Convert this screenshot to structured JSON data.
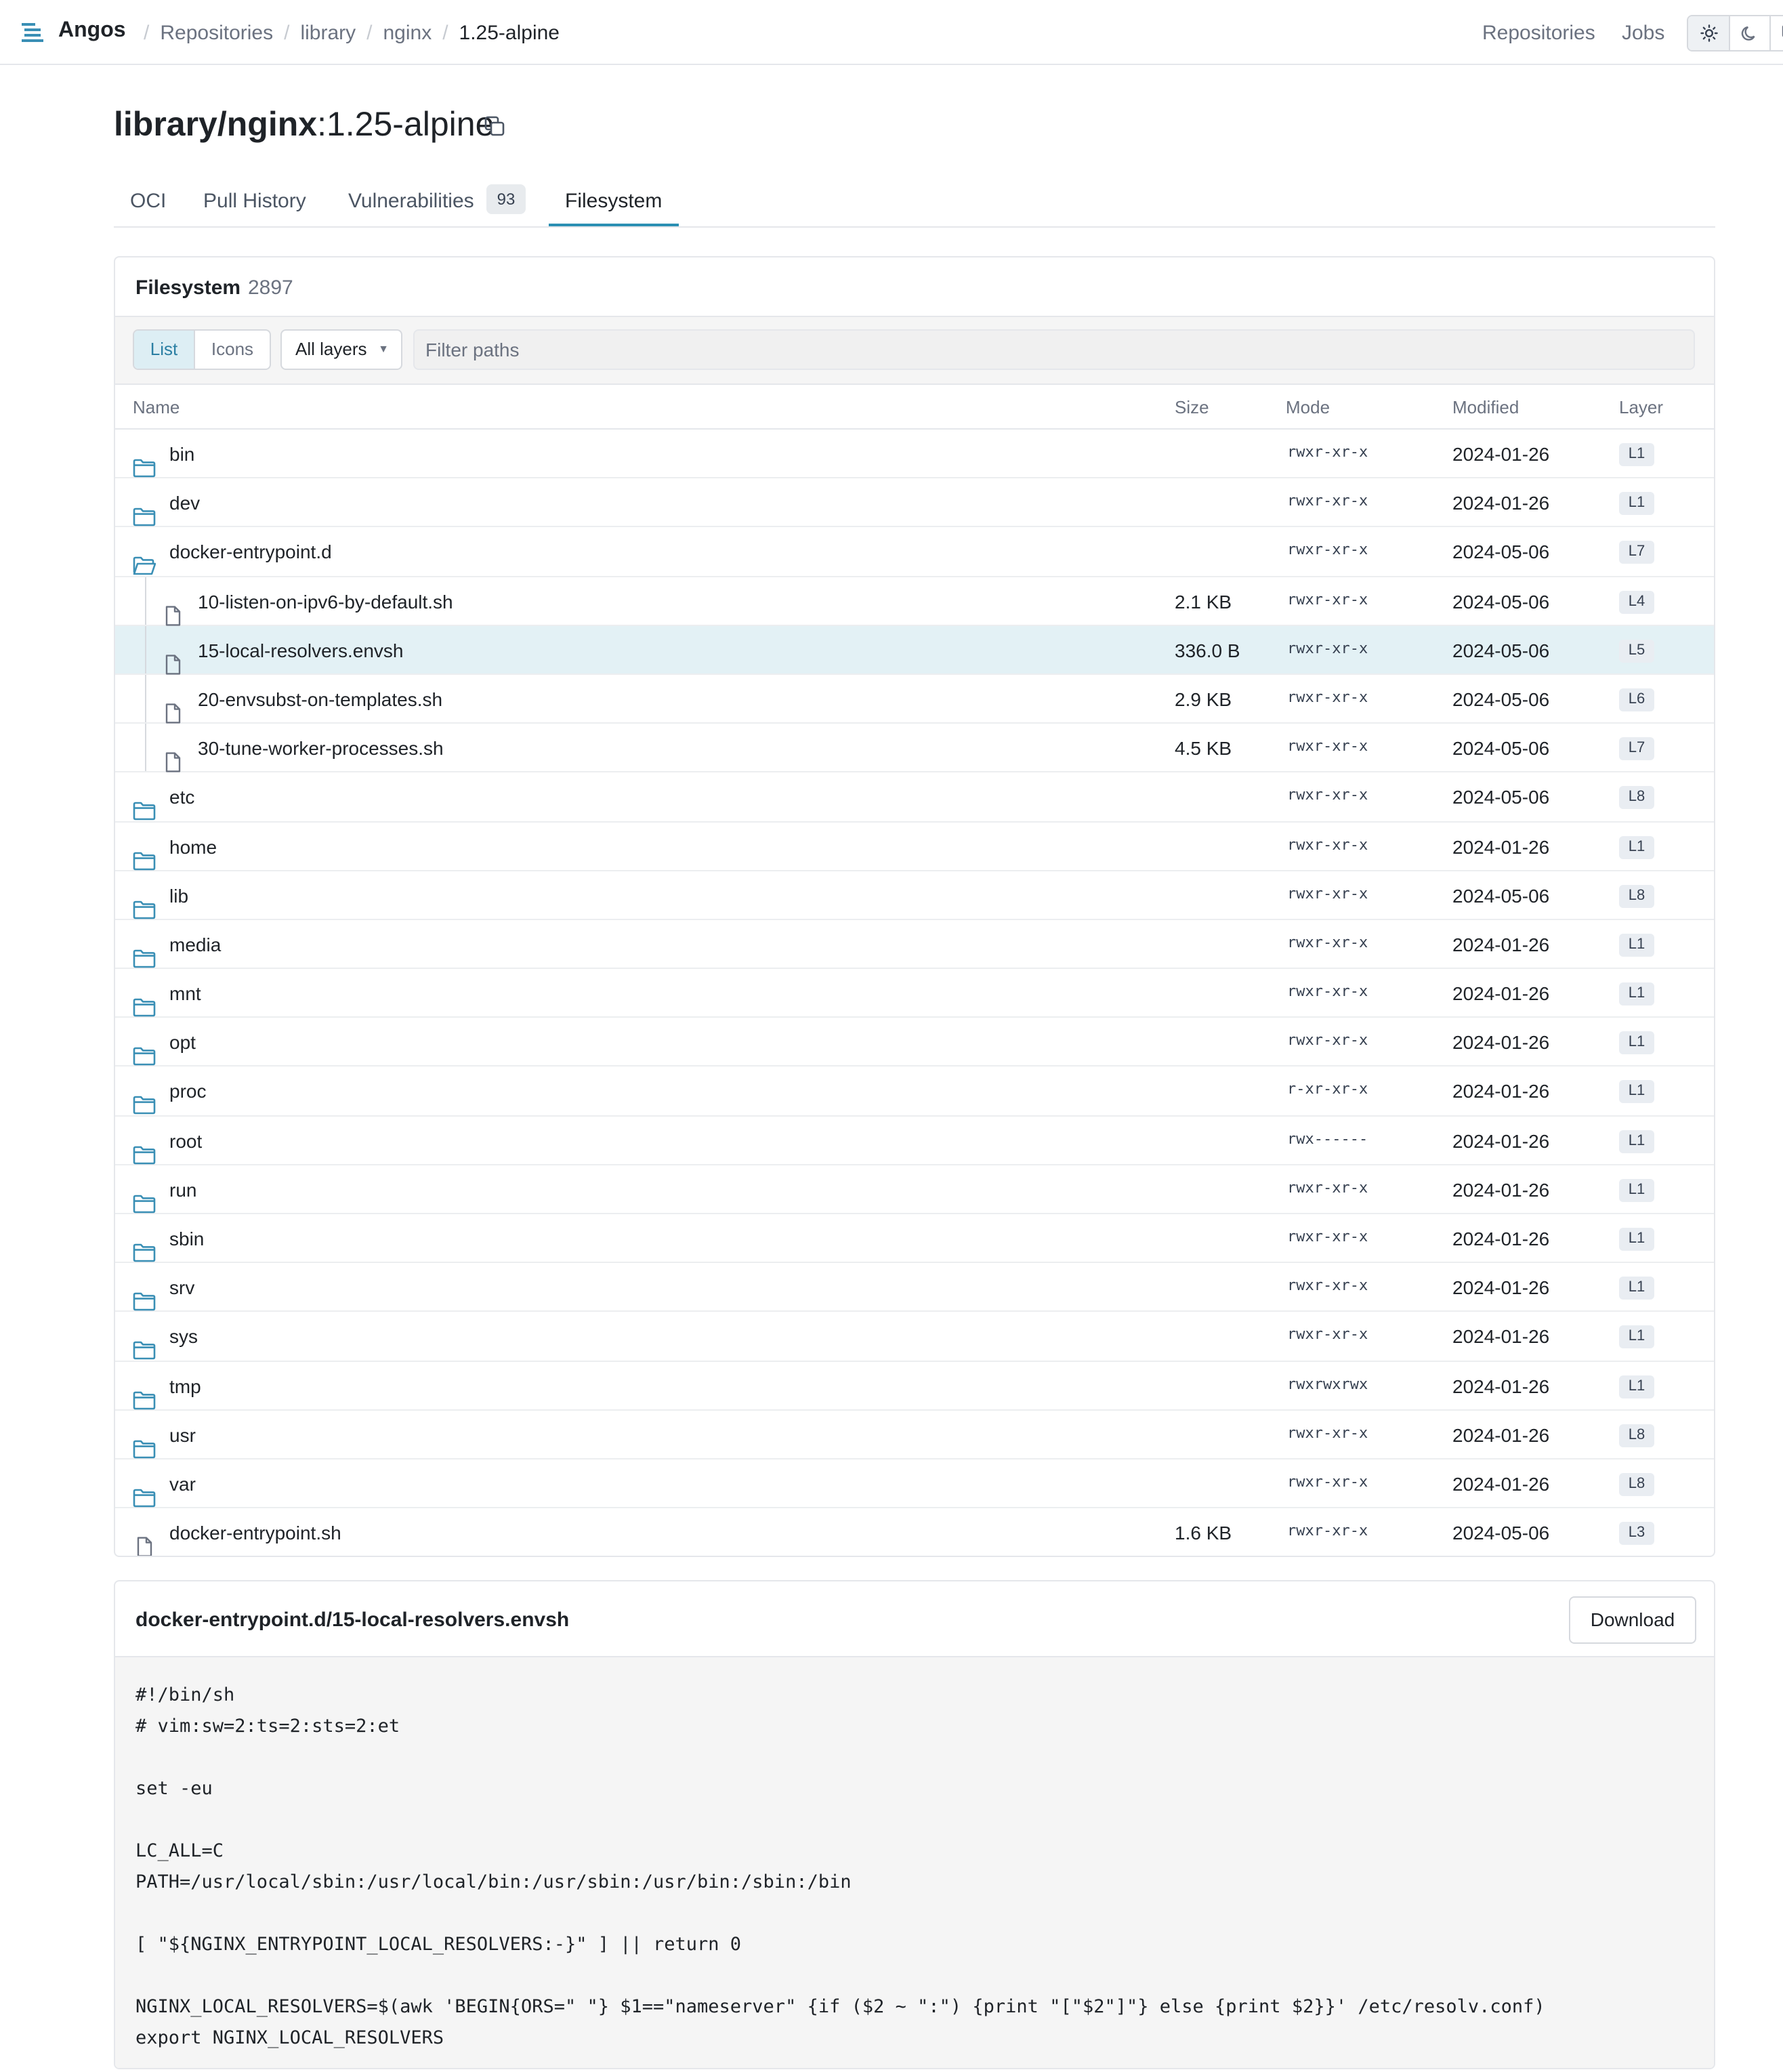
{
  "app": {
    "name": "Angos"
  },
  "breadcrumb": [
    "Repositories",
    "library",
    "nginx",
    "1.25-alpine"
  ],
  "topnav": {
    "repositories": "Repositories",
    "jobs": "Jobs"
  },
  "theme": {
    "options": [
      "sun-icon",
      "moon-icon",
      "monitor-icon"
    ],
    "selected": "sun-icon"
  },
  "title": {
    "repo": "library/nginx",
    "tag": ":1.25-alpine"
  },
  "tabs": [
    {
      "label": "OCI"
    },
    {
      "label": "Pull History"
    },
    {
      "label": "Vulnerabilities",
      "badge": "93"
    },
    {
      "label": "Filesystem",
      "active": true
    }
  ],
  "filesystem": {
    "title": "Filesystem",
    "count": "2897",
    "view_options": [
      "List",
      "Icons"
    ],
    "selected_view": "List",
    "layers_select": "All layers",
    "filter_placeholder": "Filter paths",
    "columns": {
      "name": "Name",
      "size": "Size",
      "mode": "Mode",
      "modified": "Modified",
      "layer": "Layer"
    },
    "rows": [
      {
        "name": "bin",
        "type": "dir",
        "size": "",
        "mode": "rwxr-xr-x",
        "modified": "2024-01-26",
        "layer": "L1"
      },
      {
        "name": "dev",
        "type": "dir",
        "size": "",
        "mode": "rwxr-xr-x",
        "modified": "2024-01-26",
        "layer": "L1"
      },
      {
        "name": "docker-entrypoint.d",
        "type": "dir-open",
        "size": "",
        "mode": "rwxr-xr-x",
        "modified": "2024-05-06",
        "layer": "L7"
      },
      {
        "name": "10-listen-on-ipv6-by-default.sh",
        "type": "file",
        "child": true,
        "size": "2.1 KB",
        "mode": "rwxr-xr-x",
        "modified": "2024-05-06",
        "layer": "L4"
      },
      {
        "name": "15-local-resolvers.envsh",
        "type": "file",
        "child": true,
        "selected": true,
        "size": "336.0 B",
        "mode": "rwxr-xr-x",
        "modified": "2024-05-06",
        "layer": "L5"
      },
      {
        "name": "20-envsubst-on-templates.sh",
        "type": "file",
        "child": true,
        "size": "2.9 KB",
        "mode": "rwxr-xr-x",
        "modified": "2024-05-06",
        "layer": "L6"
      },
      {
        "name": "30-tune-worker-processes.sh",
        "type": "file",
        "child": true,
        "size": "4.5 KB",
        "mode": "rwxr-xr-x",
        "modified": "2024-05-06",
        "layer": "L7"
      },
      {
        "name": "etc",
        "type": "dir",
        "size": "",
        "mode": "rwxr-xr-x",
        "modified": "2024-05-06",
        "layer": "L8"
      },
      {
        "name": "home",
        "type": "dir",
        "size": "",
        "mode": "rwxr-xr-x",
        "modified": "2024-01-26",
        "layer": "L1"
      },
      {
        "name": "lib",
        "type": "dir",
        "size": "",
        "mode": "rwxr-xr-x",
        "modified": "2024-05-06",
        "layer": "L8"
      },
      {
        "name": "media",
        "type": "dir",
        "size": "",
        "mode": "rwxr-xr-x",
        "modified": "2024-01-26",
        "layer": "L1"
      },
      {
        "name": "mnt",
        "type": "dir",
        "size": "",
        "mode": "rwxr-xr-x",
        "modified": "2024-01-26",
        "layer": "L1"
      },
      {
        "name": "opt",
        "type": "dir",
        "size": "",
        "mode": "rwxr-xr-x",
        "modified": "2024-01-26",
        "layer": "L1"
      },
      {
        "name": "proc",
        "type": "dir",
        "size": "",
        "mode": "r-xr-xr-x",
        "modified": "2024-01-26",
        "layer": "L1"
      },
      {
        "name": "root",
        "type": "dir",
        "size": "",
        "mode": "rwx------",
        "modified": "2024-01-26",
        "layer": "L1"
      },
      {
        "name": "run",
        "type": "dir",
        "size": "",
        "mode": "rwxr-xr-x",
        "modified": "2024-01-26",
        "layer": "L1"
      },
      {
        "name": "sbin",
        "type": "dir",
        "size": "",
        "mode": "rwxr-xr-x",
        "modified": "2024-01-26",
        "layer": "L1"
      },
      {
        "name": "srv",
        "type": "dir",
        "size": "",
        "mode": "rwxr-xr-x",
        "modified": "2024-01-26",
        "layer": "L1"
      },
      {
        "name": "sys",
        "type": "dir",
        "size": "",
        "mode": "rwxr-xr-x",
        "modified": "2024-01-26",
        "layer": "L1"
      },
      {
        "name": "tmp",
        "type": "dir",
        "size": "",
        "mode": "rwxrwxrwx",
        "modified": "2024-01-26",
        "layer": "L1"
      },
      {
        "name": "usr",
        "type": "dir",
        "size": "",
        "mode": "rwxr-xr-x",
        "modified": "2024-01-26",
        "layer": "L8"
      },
      {
        "name": "var",
        "type": "dir",
        "size": "",
        "mode": "rwxr-xr-x",
        "modified": "2024-01-26",
        "layer": "L8"
      },
      {
        "name": "docker-entrypoint.sh",
        "type": "file",
        "size": "1.6 KB",
        "mode": "rwxr-xr-x",
        "modified": "2024-05-06",
        "layer": "L3"
      }
    ]
  },
  "viewer": {
    "path": "docker-entrypoint.d/15-local-resolvers.envsh",
    "download_label": "Download",
    "code_lines": [
      "#!/bin/sh",
      "# vim:sw=2:ts=2:sts=2:et",
      "",
      "set -eu",
      "",
      "LC_ALL=C",
      "PATH=/usr/local/sbin:/usr/local/bin:/usr/sbin:/usr/bin:/sbin:/bin",
      "",
      "[ \"${NGINX_ENTRYPOINT_LOCAL_RESOLVERS:-}\" ] || return 0",
      "",
      "NGINX_LOCAL_RESOLVERS=$(awk 'BEGIN{ORS=\" \"} $1==\"nameserver\" {if ($2 ~ \":\") {print \"[\"$2\"]\"} else {print $2}}' /etc/resolv.conf)",
      "export NGINX_LOCAL_RESOLVERS"
    ]
  },
  "colors": {
    "accent": "#2b8fb3",
    "selected_row": "#e3f1f5",
    "folder_icon": "#3a8fb5"
  }
}
